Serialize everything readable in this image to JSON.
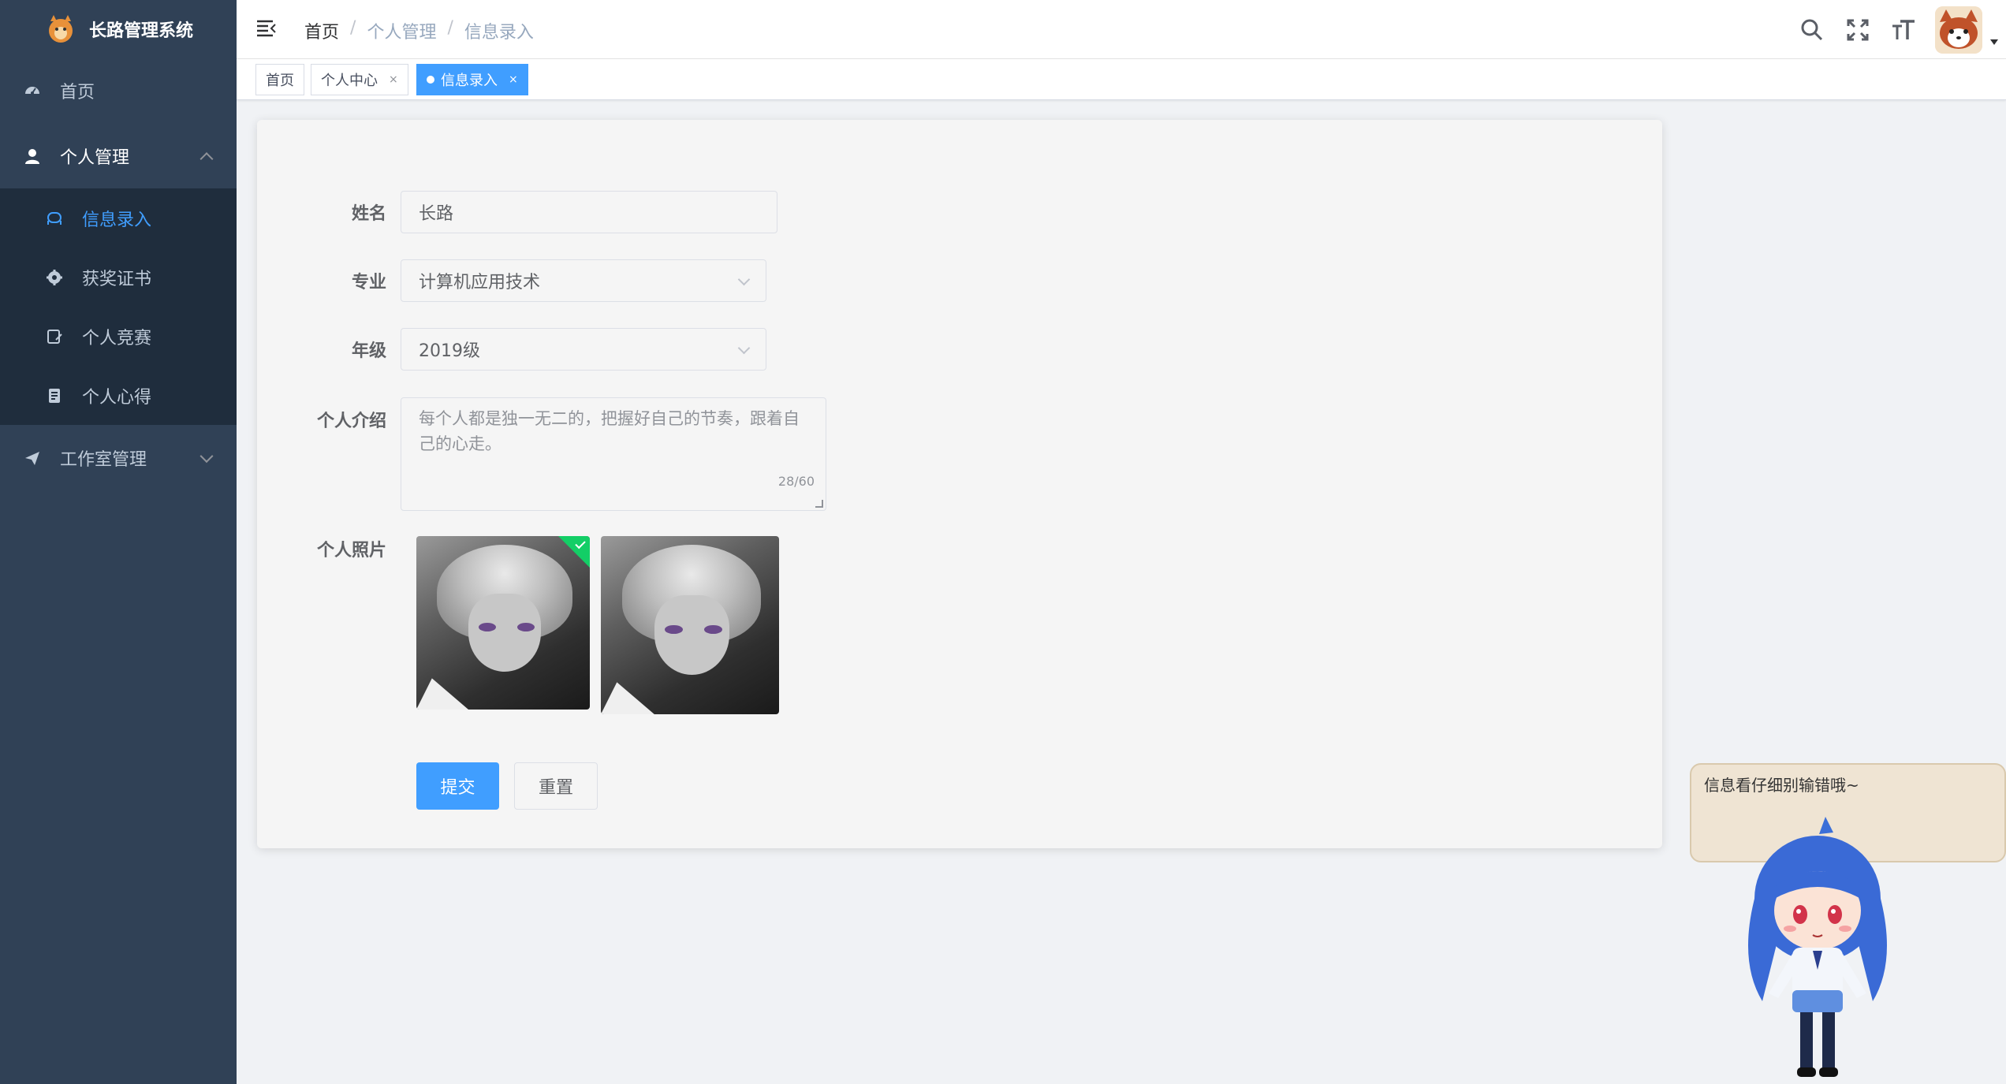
{
  "app": {
    "title": "长路管理系统"
  },
  "sidebar": {
    "items": [
      {
        "label": "首页",
        "icon": "dashboard-icon"
      },
      {
        "label": "个人管理",
        "icon": "user-icon",
        "expanded": true,
        "children": [
          {
            "label": "信息录入",
            "icon": "info-entry-icon",
            "active": true
          },
          {
            "label": "获奖证书",
            "icon": "gear-icon"
          },
          {
            "label": "个人竞赛",
            "icon": "competition-icon"
          },
          {
            "label": "个人心得",
            "icon": "notes-icon"
          }
        ]
      },
      {
        "label": "工作室管理",
        "icon": "send-icon",
        "expanded": false
      }
    ]
  },
  "navbar": {
    "breadcrumb": [
      "首页",
      "个人管理",
      "信息录入"
    ],
    "separator": "/",
    "tools": [
      "search-icon",
      "fullscreen-icon",
      "font-size-icon",
      "avatar"
    ]
  },
  "tags": [
    {
      "label": "首页",
      "closable": false
    },
    {
      "label": "个人中心",
      "closable": true
    },
    {
      "label": "信息录入",
      "closable": true,
      "active": true
    }
  ],
  "tag_close": "×",
  "form": {
    "name": {
      "label": "姓名",
      "value": "长路"
    },
    "major": {
      "label": "专业",
      "value": "计算机应用技术"
    },
    "grade": {
      "label": "年级",
      "value": "2019级"
    },
    "intro": {
      "label": "个人介绍",
      "value": "每个人都是独一无二的，把握好自己的节奏，跟着自己的心走。",
      "counter": "28/60"
    },
    "photo": {
      "label": "个人照片"
    },
    "submit": "提交",
    "reset": "重置"
  },
  "mascot": {
    "message": "信息看仔细别输错哦~"
  },
  "colors": {
    "sidebar": "#304156",
    "submenu": "#1f2d3d",
    "accent": "#409eff",
    "success": "#13ce66"
  }
}
